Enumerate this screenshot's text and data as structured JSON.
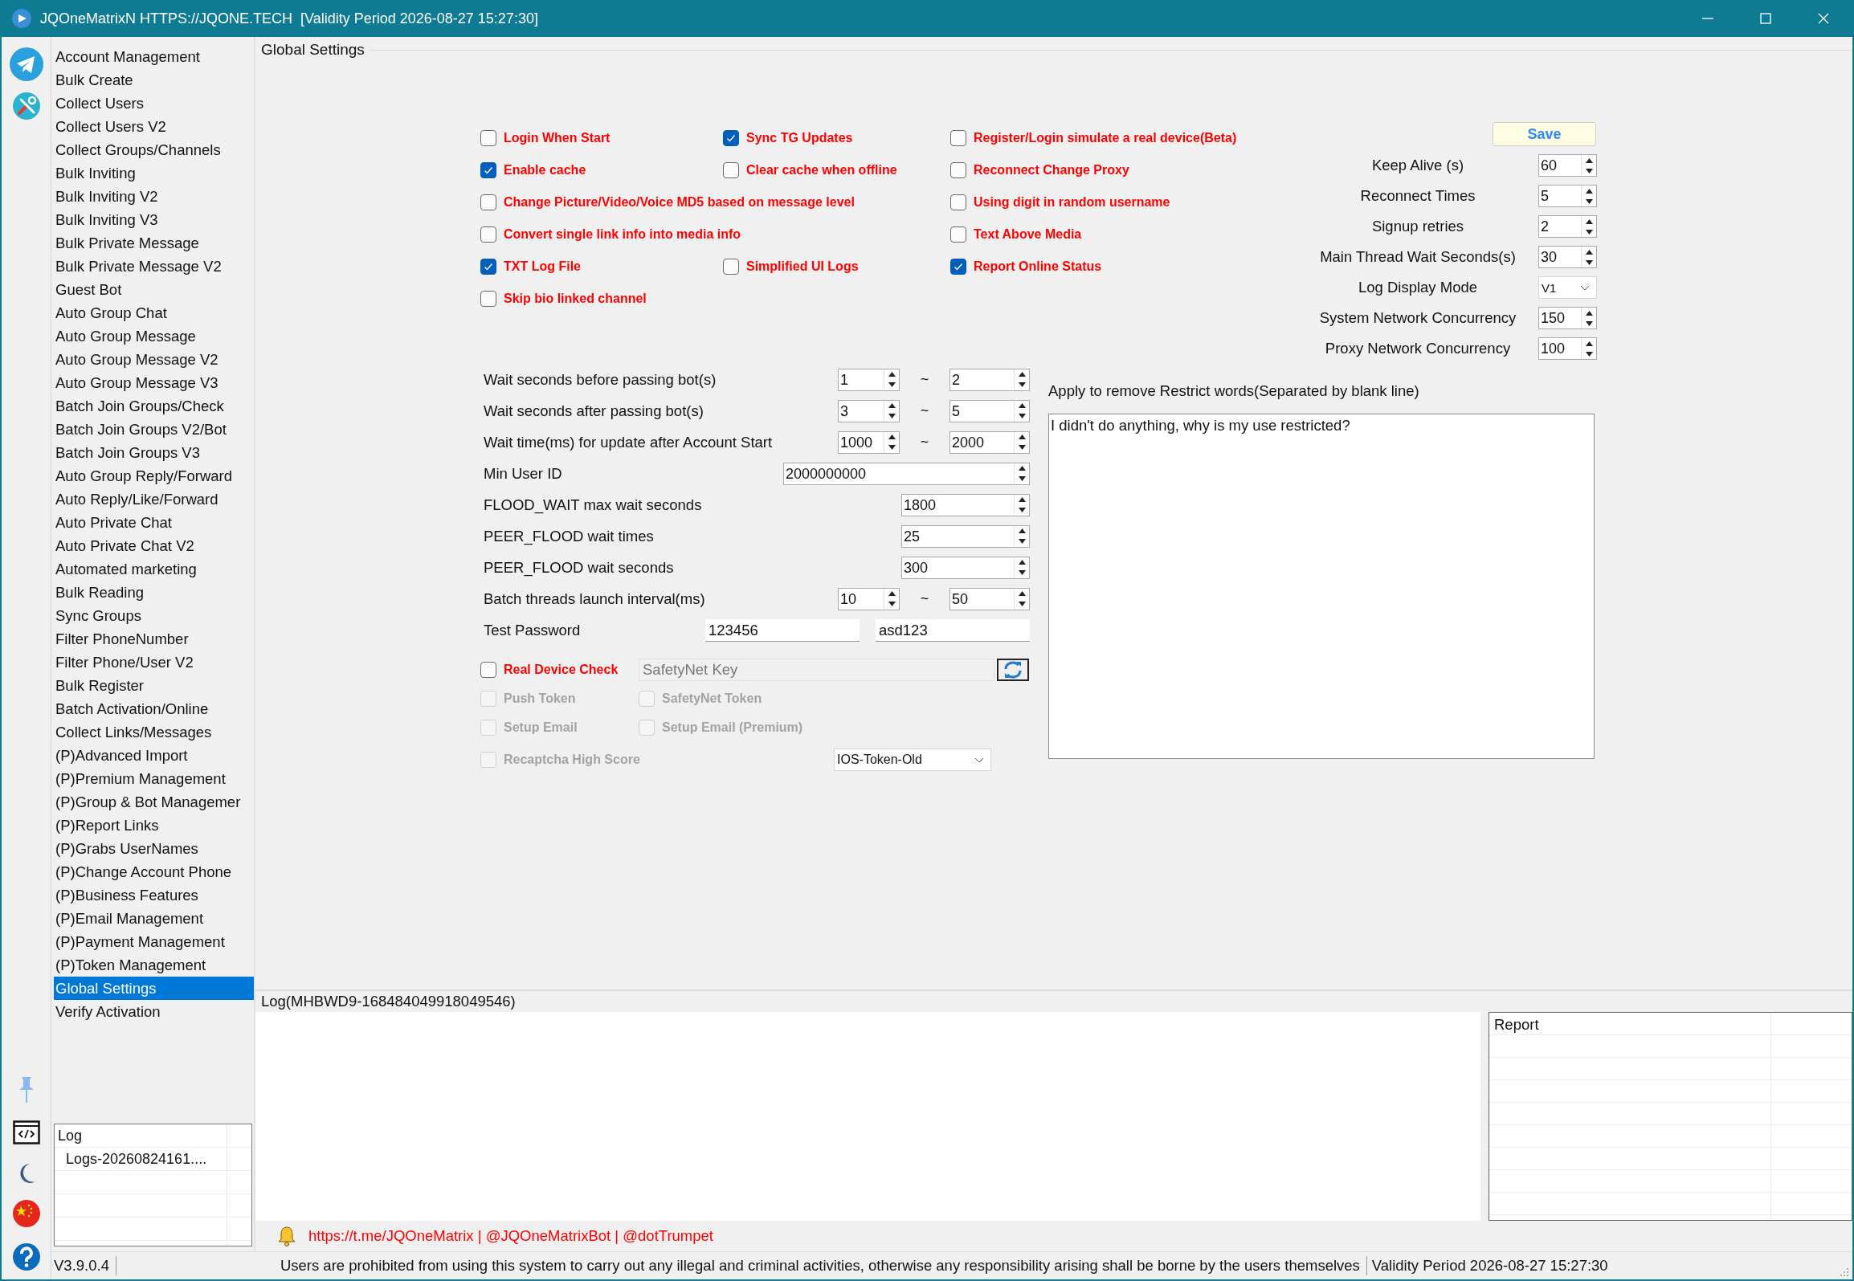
{
  "window": {
    "title": "JQOneMatrixN HTTPS://JQONE.TECH  [Validity Period 2026-08-27 15:27:30]"
  },
  "sidebar": {
    "items": [
      {
        "label": "Account Management",
        "selected": false
      },
      {
        "label": "Bulk Create",
        "selected": false
      },
      {
        "label": "Collect Users",
        "selected": false
      },
      {
        "label": "Collect Users V2",
        "selected": false
      },
      {
        "label": "Collect Groups/Channels",
        "selected": false
      },
      {
        "label": "Bulk Inviting",
        "selected": false
      },
      {
        "label": "Bulk Inviting V2",
        "selected": false
      },
      {
        "label": "Bulk Inviting V3",
        "selected": false
      },
      {
        "label": "Bulk Private Message",
        "selected": false
      },
      {
        "label": "Bulk Private Message V2",
        "selected": false
      },
      {
        "label": "Guest Bot",
        "selected": false
      },
      {
        "label": "Auto Group Chat",
        "selected": false
      },
      {
        "label": "Auto Group Message",
        "selected": false
      },
      {
        "label": "Auto Group Message V2",
        "selected": false
      },
      {
        "label": "Auto Group Message V3",
        "selected": false
      },
      {
        "label": "Batch Join Groups/Check",
        "selected": false
      },
      {
        "label": "Batch Join Groups V2/Bot",
        "selected": false
      },
      {
        "label": "Batch Join Groups V3",
        "selected": false
      },
      {
        "label": "Auto Group Reply/Forward",
        "selected": false
      },
      {
        "label": "Auto Reply/Like/Forward",
        "selected": false
      },
      {
        "label": "Auto Private Chat",
        "selected": false
      },
      {
        "label": "Auto Private Chat V2",
        "selected": false
      },
      {
        "label": "Automated marketing",
        "selected": false
      },
      {
        "label": "Bulk Reading",
        "selected": false
      },
      {
        "label": "Sync Groups",
        "selected": false
      },
      {
        "label": "Filter PhoneNumber",
        "selected": false
      },
      {
        "label": "Filter Phone/User V2",
        "selected": false
      },
      {
        "label": "Bulk Register",
        "selected": false
      },
      {
        "label": "Batch Activation/Online",
        "selected": false
      },
      {
        "label": "Collect Links/Messages",
        "selected": false
      },
      {
        "label": "(P)Advanced Import",
        "selected": false
      },
      {
        "label": "(P)Premium Management",
        "selected": false
      },
      {
        "label": "(P)Group & Bot Managemer",
        "selected": false
      },
      {
        "label": "(P)Report Links",
        "selected": false
      },
      {
        "label": "(P)Grabs UserNames",
        "selected": false
      },
      {
        "label": "(P)Change Account Phone",
        "selected": false
      },
      {
        "label": "(P)Business Features",
        "selected": false
      },
      {
        "label": "(P)Email Management",
        "selected": false
      },
      {
        "label": "(P)Payment Management",
        "selected": false
      },
      {
        "label": "(P)Token Management",
        "selected": false
      },
      {
        "label": "Global Settings",
        "selected": true
      },
      {
        "label": "Verify Activation",
        "selected": false
      }
    ]
  },
  "sidebar_log": {
    "header": "Log",
    "items": [
      "Logs-20260824161...."
    ]
  },
  "settings": {
    "title": "Global Settings",
    "option_rows": [
      {
        "kind": "triple",
        "items": [
          {
            "label": "Login When Start",
            "checked": false
          },
          {
            "label": "Sync TG Updates",
            "checked": true
          },
          {
            "label": "Register/Login simulate a real device(Beta)",
            "checked": false
          }
        ]
      },
      {
        "kind": "triple",
        "items": [
          {
            "label": "Enable cache",
            "checked": true
          },
          {
            "label": "Clear cache when offline",
            "checked": false
          },
          {
            "label": "Reconnect Change Proxy",
            "checked": false
          }
        ]
      },
      {
        "kind": "wide",
        "items": [
          {
            "label": "Change Picture/Video/Voice MD5 based on message level",
            "checked": false
          },
          {
            "label": "Using digit in random username",
            "checked": false
          }
        ]
      },
      {
        "kind": "wide",
        "items": [
          {
            "label": "Convert single link info into media info",
            "checked": false
          },
          {
            "label": "Text Above Media",
            "checked": false
          }
        ]
      },
      {
        "kind": "triple",
        "items": [
          {
            "label": "TXT Log File",
            "checked": true
          },
          {
            "label": "Simplified UI Logs",
            "checked": false
          },
          {
            "label": "Report Online Status",
            "checked": true
          }
        ]
      },
      {
        "kind": "triple",
        "items": [
          {
            "label": "Skip bio linked channel",
            "checked": false
          }
        ]
      }
    ],
    "save_button": "Save",
    "params": [
      {
        "kind": "spin",
        "label": "Keep Alive (s)",
        "value": "60"
      },
      {
        "kind": "spin",
        "label": "Reconnect Times",
        "value": "5"
      },
      {
        "kind": "spin",
        "label": "Signup retries",
        "value": "2"
      },
      {
        "kind": "spin",
        "label": "Main Thread Wait Seconds(s)",
        "value": "30"
      },
      {
        "kind": "select",
        "label": "Log Display Mode",
        "value": "V1"
      },
      {
        "kind": "spin",
        "label": "System Network Concurrency",
        "value": "150"
      },
      {
        "kind": "spin",
        "label": "Proxy Network Concurrency",
        "value": "100"
      }
    ],
    "form": [
      {
        "kind": "range",
        "label": "Wait seconds before passing bot(s)",
        "from": "1",
        "separator": "~",
        "to": "2"
      },
      {
        "kind": "range",
        "label": "Wait seconds after passing bot(s)",
        "from": "3",
        "separator": "~",
        "to": "5"
      },
      {
        "kind": "range",
        "label": "Wait time(ms) for update after Account Start",
        "from": "1000",
        "separator": "~",
        "to": "2000"
      },
      {
        "kind": "long_spin",
        "label": "Min User ID",
        "value": "2000000000"
      },
      {
        "kind": "spin",
        "label": "FLOOD_WAIT max wait seconds",
        "value": "1800"
      },
      {
        "kind": "spin",
        "label": "PEER_FLOOD wait times",
        "value": "25"
      },
      {
        "kind": "spin",
        "label": "PEER_FLOOD wait seconds",
        "value": "300"
      },
      {
        "kind": "range",
        "label": "Batch threads launch interval(ms)",
        "from": "10",
        "separator": "~",
        "to": "50"
      },
      {
        "kind": "pair",
        "label": "Test Password",
        "first": "123456",
        "second": "asd123"
      }
    ],
    "device": {
      "label": "Real Device Check",
      "checked": false,
      "key_placeholder": "SafetyNet Key"
    },
    "token_rows": [
      {
        "items": [
          {
            "label": "Push Token",
            "checked": false,
            "disabled": true
          },
          {
            "label": "SafetyNet Token",
            "checked": false,
            "disabled": true
          }
        ]
      },
      {
        "items": [
          {
            "label": "Setup Email",
            "checked": false,
            "disabled": true
          },
          {
            "label": "Setup Email (Premium)",
            "checked": false,
            "disabled": true
          }
        ]
      },
      {
        "items": [
          {
            "label": "Recaptcha High Score",
            "checked": false,
            "disabled": true
          }
        ],
        "select": "IOS-Token-Old"
      }
    ],
    "restrict": {
      "label": "Apply to remove Restrict words(Separated by blank line)",
      "text": "I didn't do anything, why is my use restricted?"
    }
  },
  "log": {
    "title": "Log(MHBWD9-168484049918049546)",
    "report_header": "Report"
  },
  "links": "https://t.me/JQOneMatrix | @JQOneMatrixBot | @dotTrumpet",
  "status_bar": {
    "version": "V3.9.0.4",
    "notice": "Users are prohibited from using this system to carry out any illegal and criminal activities, otherwise any responsibility arising shall be borne by the users themselves",
    "validity": "Validity Period 2026-08-27 15:27:30"
  }
}
